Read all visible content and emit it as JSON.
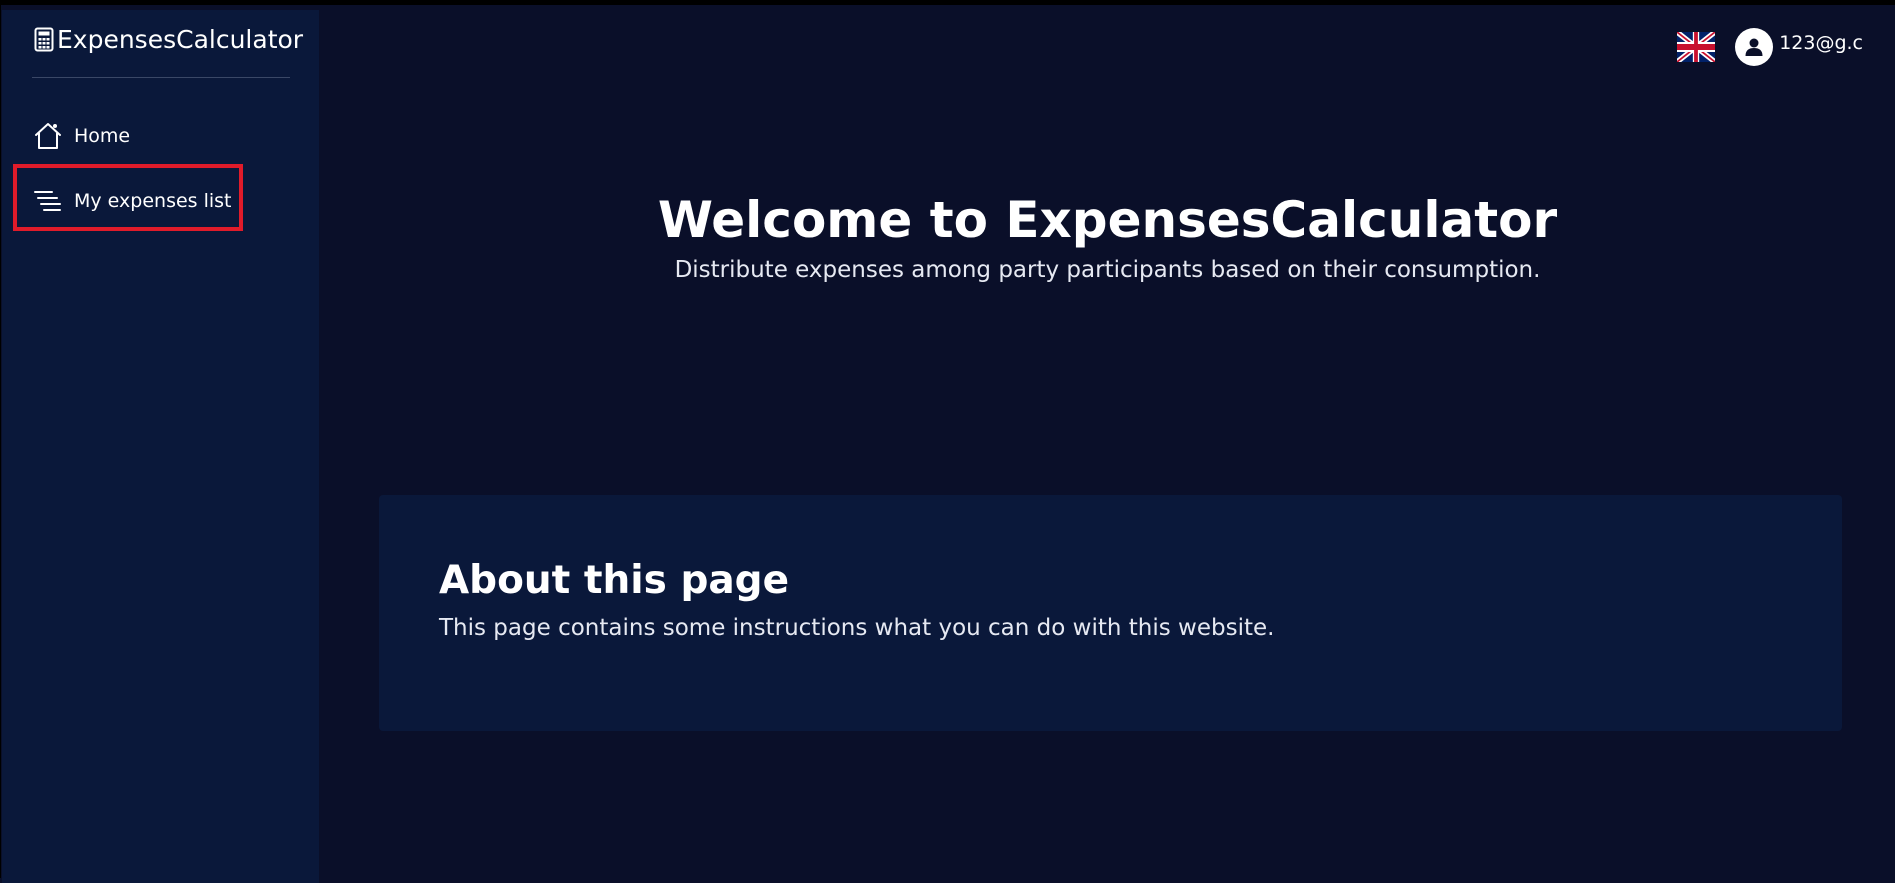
{
  "app": {
    "brand_name": "ExpensesCalculator",
    "brand_icon": "calculator-icon"
  },
  "sidebar": {
    "items": [
      {
        "label": "Home",
        "icon": "home-icon"
      },
      {
        "label": "My expenses list",
        "icon": "list-icon",
        "highlighted": true
      }
    ]
  },
  "header": {
    "language_icon": "uk-flag-icon",
    "user_icon": "user-avatar-icon",
    "user_email": "123@g.c"
  },
  "main": {
    "title": "Welcome to ExpensesCalculator",
    "subtitle": "Distribute expenses among party participants based on their consumption.",
    "about": {
      "title": "About this page",
      "text": "This page contains some instructions what you can do with this website."
    }
  },
  "colors": {
    "background": "#0a0f29",
    "sidebar_background": "#0a183a",
    "card_background": "#0a183a",
    "highlight_border": "#e01b2a",
    "text": "#ffffff"
  }
}
